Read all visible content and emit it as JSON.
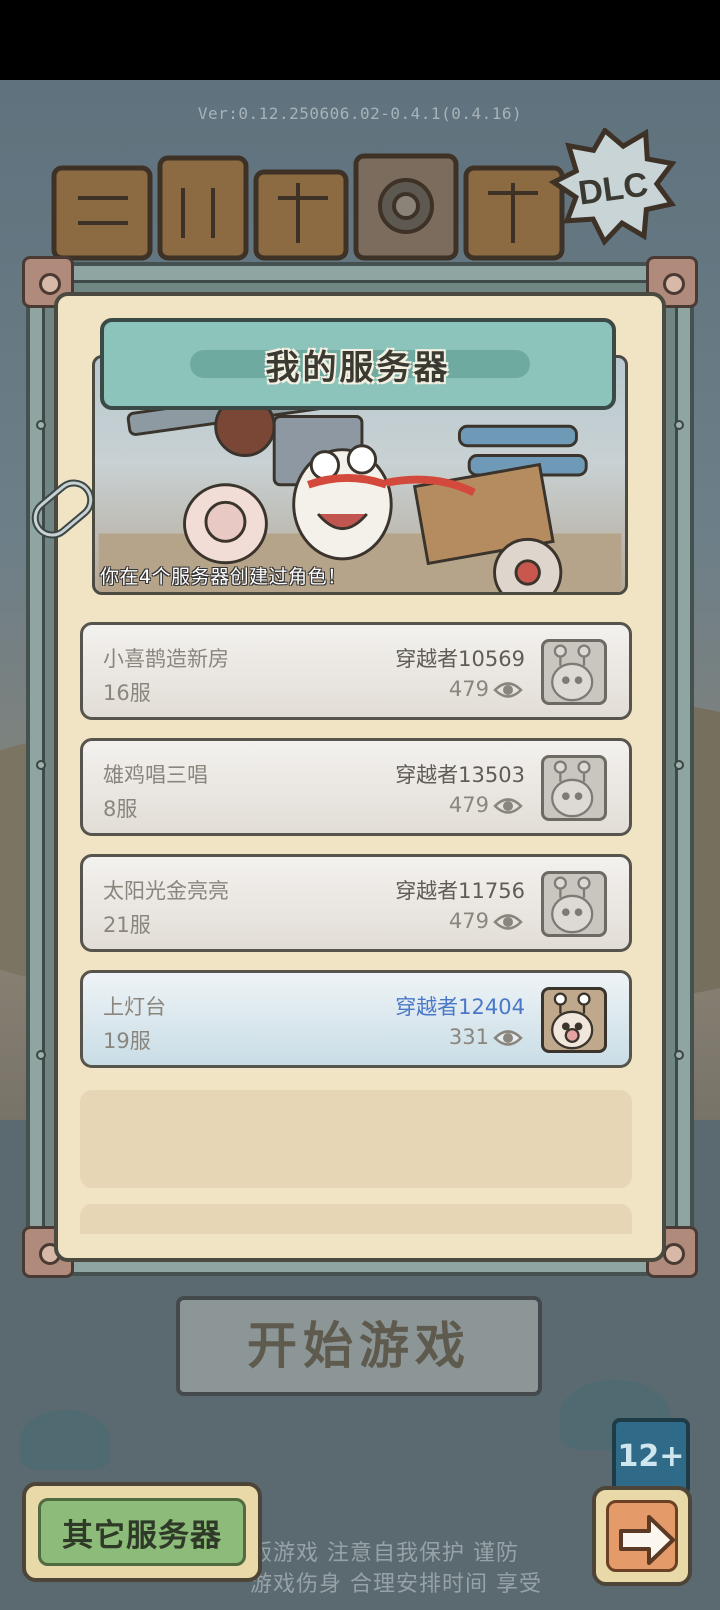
{
  "version": "Ver:0.12.250606.02-0.4.1(0.4.16)",
  "logo": {
    "badge_text": "DLC"
  },
  "dialog": {
    "title": "我的服务器",
    "created_note": "你在4个服务器创建过角色！"
  },
  "servers": [
    {
      "name": "小喜鹊造新房",
      "server": "16服",
      "character": "穿越者10569",
      "views": "479",
      "selected": false
    },
    {
      "name": "雄鸡唱三唱",
      "server": "8服",
      "character": "穿越者13503",
      "views": "479",
      "selected": false
    },
    {
      "name": "太阳光金亮亮",
      "server": "21服",
      "character": "穿越者11756",
      "views": "479",
      "selected": false
    },
    {
      "name": "上灯台",
      "server": "19服",
      "character": "穿越者12404",
      "views": "331",
      "selected": true
    }
  ],
  "start_button": "开始游戏",
  "age_rating": "12+",
  "notice": {
    "line1": "版游戏  注意自我保护  谨防",
    "line2": "游戏伤身  合理安排时间  享受"
  },
  "other_servers_button": "其它服务器",
  "colors": {
    "selected_character": "#4a78c8",
    "title_plate": "#8cc3bb",
    "other_button": "#8dbb79",
    "next_button": "#e49a69"
  },
  "icons": {
    "views": "eye-icon",
    "next": "arrow-right-icon",
    "attach": "paperclip-icon"
  }
}
